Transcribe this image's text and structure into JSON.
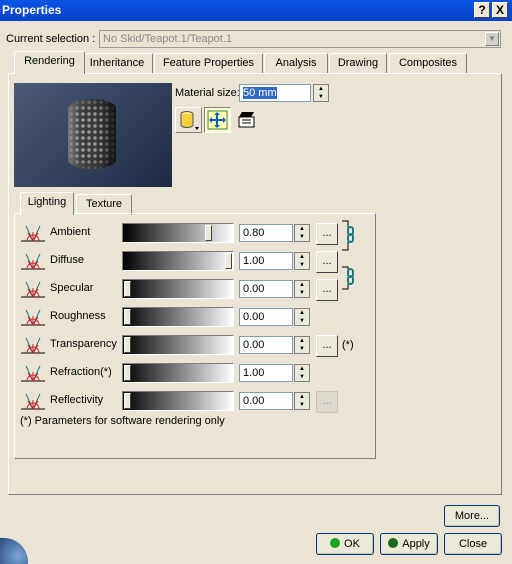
{
  "window": {
    "title": "Properties",
    "help_label": "?",
    "close_label": "X"
  },
  "selection": {
    "label": "Current selection :",
    "value": "No Skid/Teapot.1/Teapot.1",
    "arrow": "▼"
  },
  "tabs": [
    "Rendering",
    "Inheritance",
    "Feature Properties",
    "Analysis",
    "Drawing",
    "Composites"
  ],
  "active_tab": "Rendering",
  "material": {
    "label": "Material size:",
    "value": "50 mm"
  },
  "icons": [
    "cylinder-mapping-icon",
    "fit-adjust-icon",
    "mapping-editor-icon"
  ],
  "subtabs": [
    "Lighting",
    "Texture"
  ],
  "active_subtab": "Lighting",
  "rows": [
    {
      "label": "Ambient",
      "value": "0.80",
      "fraction": 0.8,
      "icon": "ambient-icon",
      "has_dots": true,
      "dots_enabled": true,
      "note": ""
    },
    {
      "label": "Diffuse",
      "value": "1.00",
      "fraction": 1.0,
      "icon": "diffuse-icon",
      "has_dots": true,
      "dots_enabled": true,
      "note": ""
    },
    {
      "label": "Specular",
      "value": "0.00",
      "fraction": 0.0,
      "icon": "specular-icon",
      "has_dots": true,
      "dots_enabled": true,
      "note": ""
    },
    {
      "label": "Roughness",
      "value": "0.00",
      "fraction": 0.0,
      "icon": "roughness-icon",
      "has_dots": false,
      "dots_enabled": false,
      "note": ""
    },
    {
      "label": "Transparency",
      "value": "0.00",
      "fraction": 0.0,
      "icon": "transparency-icon",
      "has_dots": true,
      "dots_enabled": true,
      "note": "(*)"
    },
    {
      "label": "Refraction(*)",
      "value": "1.00",
      "fraction": 0.0,
      "icon": "refraction-icon",
      "has_dots": false,
      "dots_enabled": false,
      "note": ""
    },
    {
      "label": "Reflectivity",
      "value": "0.00",
      "fraction": 0.0,
      "icon": "reflectivity-icon",
      "has_dots": true,
      "dots_enabled": false,
      "note": ""
    }
  ],
  "dots_label": "...",
  "footnote": "(*) Parameters for software rendering only",
  "buttons": {
    "more": "More...",
    "ok": "OK",
    "apply": "Apply",
    "close": "Close"
  },
  "colors": {
    "title_bar": "#0a54e6",
    "ok_led": "#1aa51a",
    "apply_led": "#1a6a1a"
  }
}
